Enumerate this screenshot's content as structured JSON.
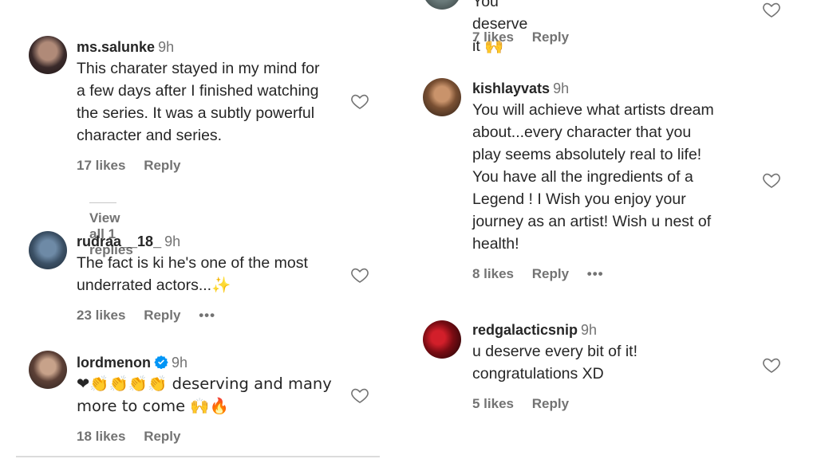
{
  "left_column": [
    {
      "username": "ms.salunke",
      "time": "9h",
      "lines": [
        "This charater stayed in my mind for",
        "a few days after I finished watching",
        "the series. It was a subtly powerful",
        "character and series."
      ],
      "likes": "17 likes",
      "reply": "Reply",
      "view_replies": "View all 1 replies"
    },
    {
      "username": "rudraa__18_",
      "time": "9h",
      "lines": [
        "The fact is ki he's one of the most",
        "underrated actors...✨"
      ],
      "likes": "23 likes",
      "reply": "Reply",
      "more": "•••"
    },
    {
      "username": "lordmenon",
      "verified": true,
      "time": "9h",
      "lines": [
        "❤👏👏👏👏 deserving and many",
        "more to come 🙌🔥"
      ],
      "likes": "18 likes",
      "reply": "Reply"
    }
  ],
  "right_column": [
    {
      "partial_text": "You deserve it 🙌",
      "likes": "7 likes",
      "reply": "Reply"
    },
    {
      "username": "kishlayvats",
      "time": "9h",
      "lines": [
        "You will achieve what artists dream",
        "about...every character that you",
        "play seems absolutely real to life!",
        "You have all the ingredients of a",
        "Legend ! I Wish you enjoy your",
        "journey as an artist! Wish u nest of",
        "health!"
      ],
      "likes": "8 likes",
      "reply": "Reply",
      "more": "•••"
    },
    {
      "username": "redgalacticsnip",
      "time": "9h",
      "lines": [
        "u deserve every bit of it!",
        "congratulations XD"
      ],
      "likes": "5 likes",
      "reply": "Reply"
    }
  ],
  "icons": {
    "heart": "heart-outline-icon",
    "verified": "verified-badge-icon",
    "more": "more-options-icon"
  },
  "colors": {
    "text": "#262626",
    "secondary": "#737373",
    "verified": "#0095f6"
  }
}
